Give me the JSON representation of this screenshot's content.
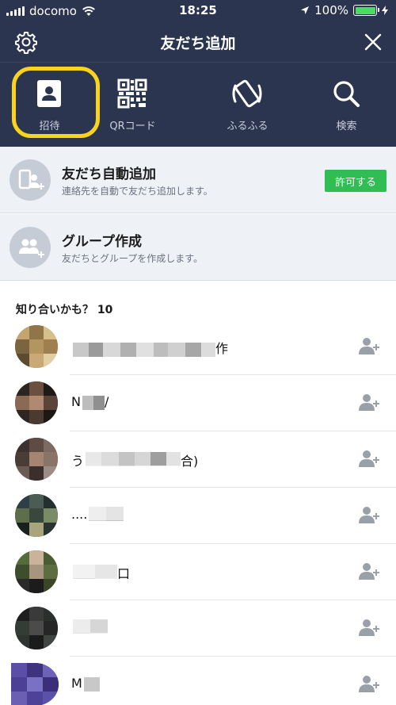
{
  "status_bar": {
    "carrier": "docomo",
    "time": "18:25",
    "battery": "100%"
  },
  "header": {
    "title": "友だち追加"
  },
  "tools": [
    {
      "label": "招待",
      "icon": "contact-card-icon"
    },
    {
      "label": "QRコード",
      "icon": "qr-code-icon"
    },
    {
      "label": "ふるふる",
      "icon": "shake-phone-icon"
    },
    {
      "label": "検索",
      "icon": "search-icon"
    }
  ],
  "auto_add": {
    "title": "友だち自動追加",
    "subtitle": "連絡先を自動で友だち追加します。",
    "button": "許可する"
  },
  "group_create": {
    "title": "グループ作成",
    "subtitle": "友だちとグループを作成します。"
  },
  "suggestions": {
    "title": "知り合いかも？ 10",
    "friends": [
      {
        "name_prefix": "",
        "name_suffix": "作"
      },
      {
        "name_prefix": "N",
        "name_suffix": "/"
      },
      {
        "name_prefix": "う",
        "name_suffix": "合)"
      },
      {
        "name_prefix": "....",
        "name_suffix": ""
      },
      {
        "name_prefix": "",
        "name_suffix": "口"
      },
      {
        "name_prefix": "",
        "name_suffix": ""
      },
      {
        "name_prefix": "M",
        "name_suffix": ""
      }
    ]
  },
  "colors": {
    "header_bg": "#2b3550",
    "highlight": "#f9d31c",
    "allow_button": "#2fbd54",
    "feature_bg": "#eef1f5"
  }
}
